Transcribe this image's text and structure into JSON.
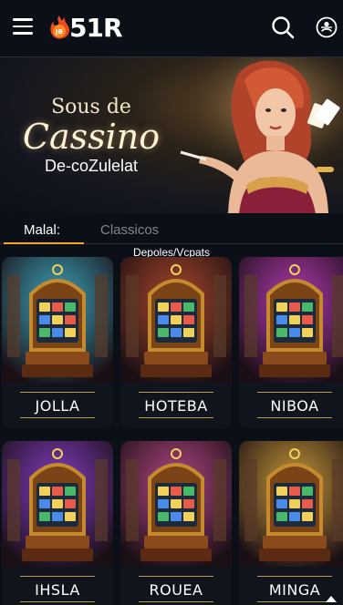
{
  "header": {
    "logo_text": "51R",
    "logo_badge": "JB",
    "menu_icon": "hamburger-icon",
    "search_icon": "search-icon",
    "user_icon": "user-icon"
  },
  "banner": {
    "line1": "Sous de",
    "line2": "Cassino",
    "line3": "De-coZulelat"
  },
  "tabs": [
    {
      "label": "Malal:",
      "active": true
    },
    {
      "label": "Classicos",
      "active": false
    }
  ],
  "section_title": "Depoles/Vcpats",
  "games": [
    {
      "label": "JOLLA",
      "theme": "#3fb0c9"
    },
    {
      "label": "HOTEBA",
      "theme": "#b74a2a"
    },
    {
      "label": "NIBOA",
      "theme": "#c03cbf"
    },
    {
      "label": "IHSLA",
      "theme": "#8b3fd0"
    },
    {
      "label": "ROUEA",
      "theme": "#c04a8e"
    },
    {
      "label": "MINGA",
      "theme": "#d7a23a"
    }
  ],
  "colors": {
    "accent": "#f5a623",
    "background": "#0b0f17",
    "tab_inactive": "#7d8492"
  }
}
